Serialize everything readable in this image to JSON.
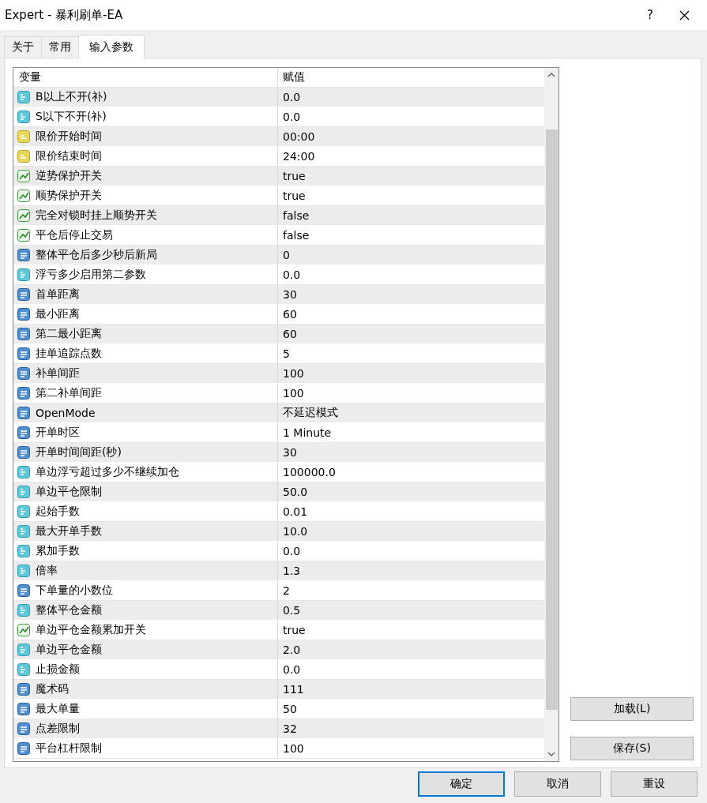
{
  "window": {
    "title": "Expert - 暴利刷单-EA",
    "help": "?"
  },
  "tabs": [
    {
      "label": "关于",
      "selected": false
    },
    {
      "label": "常用",
      "selected": false
    },
    {
      "label": "输入参数",
      "selected": true
    }
  ],
  "table": {
    "columns": [
      "变量",
      "赋值"
    ],
    "rows": [
      {
        "kind": "double",
        "name": "B以上不开(补)",
        "value": "0.0"
      },
      {
        "kind": "double",
        "name": "S以下不开(补)",
        "value": "0.0"
      },
      {
        "kind": "string",
        "name": "限价开始时间",
        "value": "00:00"
      },
      {
        "kind": "string",
        "name": "限价结束时间",
        "value": "24:00"
      },
      {
        "kind": "bool",
        "name": "逆势保护开关",
        "value": "true"
      },
      {
        "kind": "bool",
        "name": "顺势保护开关",
        "value": "true"
      },
      {
        "kind": "bool",
        "name": "完全对锁时挂上顺势开关",
        "value": "false"
      },
      {
        "kind": "bool",
        "name": "平仓后停止交易",
        "value": "false"
      },
      {
        "kind": "int",
        "name": "整体平仓后多少秒后新局",
        "value": "0"
      },
      {
        "kind": "double",
        "name": "浮亏多少启用第二参数",
        "value": "0.0"
      },
      {
        "kind": "int",
        "name": "首单距离",
        "value": "30"
      },
      {
        "kind": "int",
        "name": "最小距离",
        "value": "60"
      },
      {
        "kind": "int",
        "name": "第二最小距离",
        "value": "60"
      },
      {
        "kind": "int",
        "name": "挂单追踪点数",
        "value": "5"
      },
      {
        "kind": "int",
        "name": "补单间距",
        "value": "100"
      },
      {
        "kind": "int",
        "name": "第二补单间距",
        "value": "100"
      },
      {
        "kind": "int",
        "name": "OpenMode",
        "value": "不延迟模式"
      },
      {
        "kind": "int",
        "name": "开单时区",
        "value": "1 Minute"
      },
      {
        "kind": "int",
        "name": "开单时间间距(秒)",
        "value": "30"
      },
      {
        "kind": "double",
        "name": "单边浮亏超过多少不继续加仓",
        "value": "100000.0"
      },
      {
        "kind": "double",
        "name": "单边平仓限制",
        "value": "50.0"
      },
      {
        "kind": "double",
        "name": "起始手数",
        "value": "0.01"
      },
      {
        "kind": "double",
        "name": "最大开单手数",
        "value": "10.0"
      },
      {
        "kind": "double",
        "name": "累加手数",
        "value": "0.0"
      },
      {
        "kind": "double",
        "name": "倍率",
        "value": "1.3"
      },
      {
        "kind": "int",
        "name": "下单量的小数位",
        "value": "2"
      },
      {
        "kind": "double",
        "name": "整体平仓金额",
        "value": "0.5"
      },
      {
        "kind": "bool",
        "name": "单边平仓金额累加开关",
        "value": "true"
      },
      {
        "kind": "double",
        "name": "单边平仓金额",
        "value": "2.0"
      },
      {
        "kind": "double",
        "name": "止损金额",
        "value": "0.0"
      },
      {
        "kind": "int",
        "name": "魔术码",
        "value": "111"
      },
      {
        "kind": "int",
        "name": "最大单量",
        "value": "50"
      },
      {
        "kind": "int",
        "name": "点差限制",
        "value": "32"
      },
      {
        "kind": "int",
        "name": "平台杠杆限制",
        "value": "100"
      }
    ]
  },
  "side_buttons": [
    "加载(L)",
    "保存(S)"
  ],
  "footer_buttons": [
    {
      "label": "确定",
      "default": true
    },
    {
      "label": "取消",
      "default": false
    },
    {
      "label": "重设",
      "default": false
    }
  ]
}
